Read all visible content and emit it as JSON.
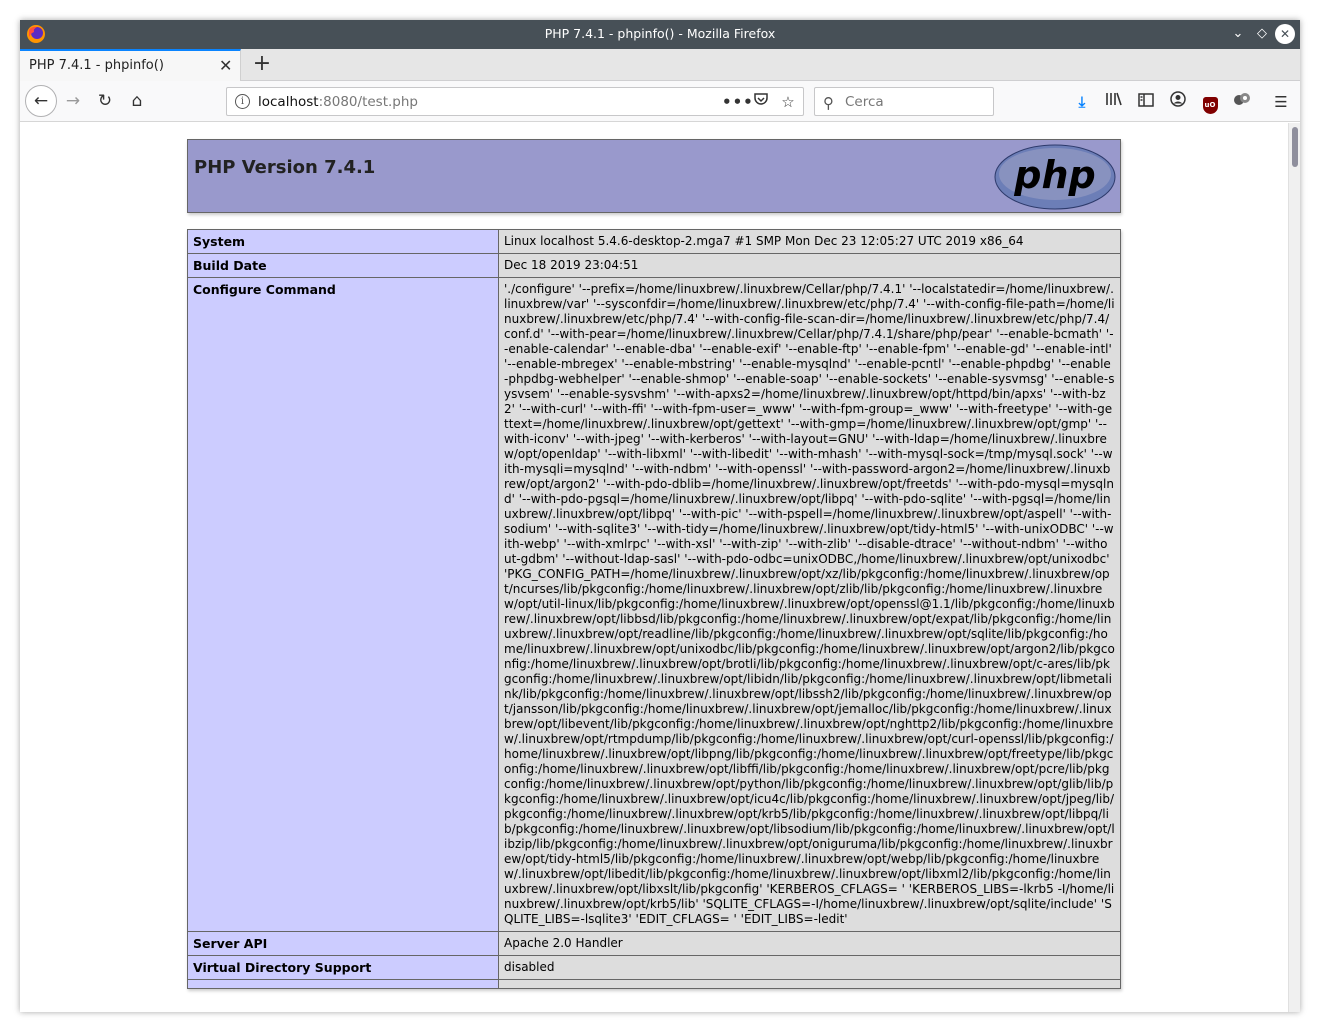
{
  "window": {
    "title": "PHP 7.4.1 - phpinfo() - Mozilla Firefox"
  },
  "tab": {
    "title": "PHP 7.4.1 - phpinfo()"
  },
  "urlbar": {
    "host": "localhost",
    "rest": ":8080/test.php"
  },
  "search": {
    "placeholder": "Cerca"
  },
  "page": {
    "heading": "PHP Version 7.4.1",
    "logo_text": "php",
    "rows": [
      {
        "key": "System",
        "value": "Linux localhost 5.4.6-desktop-2.mga7 #1 SMP Mon Dec 23 12:05:27 UTC 2019 x86_64"
      },
      {
        "key": "Build Date",
        "value": "Dec 18 2019 23:04:51"
      },
      {
        "key": "Configure Command",
        "value": "'./configure' '--prefix=/home/linuxbrew/.linuxbrew/Cellar/php/7.4.1' '--localstatedir=/home/linuxbrew/.linuxbrew/var' '--sysconfdir=/home/linuxbrew/.linuxbrew/etc/php/7.4' '--with-config-file-path=/home/linuxbrew/.linuxbrew/etc/php/7.4' '--with-config-file-scan-dir=/home/linuxbrew/.linuxbrew/etc/php/7.4/conf.d' '--with-pear=/home/linuxbrew/.linuxbrew/Cellar/php/7.4.1/share/php/pear' '--enable-bcmath' '--enable-calendar' '--enable-dba' '--enable-exif' '--enable-ftp' '--enable-fpm' '--enable-gd' '--enable-intl' '--enable-mbregex' '--enable-mbstring' '--enable-mysqlnd' '--enable-pcntl' '--enable-phpdbg' '--enable-phpdbg-webhelper' '--enable-shmop' '--enable-soap' '--enable-sockets' '--enable-sysvmsg' '--enable-sysvsem' '--enable-sysvshm' '--with-apxs2=/home/linuxbrew/.linuxbrew/opt/httpd/bin/apxs' '--with-bz2' '--with-curl' '--with-ffi' '--with-fpm-user=_www' '--with-fpm-group=_www' '--with-freetype' '--with-gettext=/home/linuxbrew/.linuxbrew/opt/gettext' '--with-gmp=/home/linuxbrew/.linuxbrew/opt/gmp' '--with-iconv' '--with-jpeg' '--with-kerberos' '--with-layout=GNU' '--with-ldap=/home/linuxbrew/.linuxbrew/opt/openldap' '--with-libxml' '--with-libedit' '--with-mhash' '--with-mysql-sock=/tmp/mysql.sock' '--with-mysqli=mysqlnd' '--with-ndbm' '--with-openssl' '--with-password-argon2=/home/linuxbrew/.linuxbrew/opt/argon2' '--with-pdo-dblib=/home/linuxbrew/.linuxbrew/opt/freetds' '--with-pdo-mysql=mysqlnd' '--with-pdo-pgsql=/home/linuxbrew/.linuxbrew/opt/libpq' '--with-pdo-sqlite' '--with-pgsql=/home/linuxbrew/.linuxbrew/opt/libpq' '--with-pic' '--with-pspell=/home/linuxbrew/.linuxbrew/opt/aspell' '--with-sodium' '--with-sqlite3' '--with-tidy=/home/linuxbrew/.linuxbrew/opt/tidy-html5' '--with-unixODBC' '--with-webp' '--with-xmlrpc' '--with-xsl' '--with-zip' '--with-zlib' '--disable-dtrace' '--without-ndbm' '--without-gdbm' '--without-ldap-sasl' '--with-pdo-odbc=unixODBC,/home/linuxbrew/.linuxbrew/opt/unixodbc' 'PKG_CONFIG_PATH=/home/linuxbrew/.linuxbrew/opt/xz/lib/pkgconfig:/home/linuxbrew/.linuxbrew/opt/ncurses/lib/pkgconfig:/home/linuxbrew/.linuxbrew/opt/zlib/lib/pkgconfig:/home/linuxbrew/.linuxbrew/opt/util-linux/lib/pkgconfig:/home/linuxbrew/.linuxbrew/opt/openssl@1.1/lib/pkgconfig:/home/linuxbrew/.linuxbrew/opt/libbsd/lib/pkgconfig:/home/linuxbrew/.linuxbrew/opt/expat/lib/pkgconfig:/home/linuxbrew/.linuxbrew/opt/readline/lib/pkgconfig:/home/linuxbrew/.linuxbrew/opt/sqlite/lib/pkgconfig:/home/linuxbrew/.linuxbrew/opt/unixodbc/lib/pkgconfig:/home/linuxbrew/.linuxbrew/opt/argon2/lib/pkgconfig:/home/linuxbrew/.linuxbrew/opt/brotli/lib/pkgconfig:/home/linuxbrew/.linuxbrew/opt/c-ares/lib/pkgconfig:/home/linuxbrew/.linuxbrew/opt/libidn/lib/pkgconfig:/home/linuxbrew/.linuxbrew/opt/libmetalink/lib/pkgconfig:/home/linuxbrew/.linuxbrew/opt/libssh2/lib/pkgconfig:/home/linuxbrew/.linuxbrew/opt/jansson/lib/pkgconfig:/home/linuxbrew/.linuxbrew/opt/jemalloc/lib/pkgconfig:/home/linuxbrew/.linuxbrew/opt/libevent/lib/pkgconfig:/home/linuxbrew/.linuxbrew/opt/nghttp2/lib/pkgconfig:/home/linuxbrew/.linuxbrew/opt/rtmpdump/lib/pkgconfig:/home/linuxbrew/.linuxbrew/opt/curl-openssl/lib/pkgconfig:/home/linuxbrew/.linuxbrew/opt/libpng/lib/pkgconfig:/home/linuxbrew/.linuxbrew/opt/freetype/lib/pkgconfig:/home/linuxbrew/.linuxbrew/opt/libffi/lib/pkgconfig:/home/linuxbrew/.linuxbrew/opt/pcre/lib/pkgconfig:/home/linuxbrew/.linuxbrew/opt/python/lib/pkgconfig:/home/linuxbrew/.linuxbrew/opt/glib/lib/pkgconfig:/home/linuxbrew/.linuxbrew/opt/icu4c/lib/pkgconfig:/home/linuxbrew/.linuxbrew/opt/jpeg/lib/pkgconfig:/home/linuxbrew/.linuxbrew/opt/krb5/lib/pkgconfig:/home/linuxbrew/.linuxbrew/opt/libpq/lib/pkgconfig:/home/linuxbrew/.linuxbrew/opt/libsodium/lib/pkgconfig:/home/linuxbrew/.linuxbrew/opt/libzip/lib/pkgconfig:/home/linuxbrew/.linuxbrew/opt/oniguruma/lib/pkgconfig:/home/linuxbrew/.linuxbrew/opt/tidy-html5/lib/pkgconfig:/home/linuxbrew/.linuxbrew/opt/webp/lib/pkgconfig:/home/linuxbrew/.linuxbrew/opt/libedit/lib/pkgconfig:/home/linuxbrew/.linuxbrew/opt/libxml2/lib/pkgconfig:/home/linuxbrew/.linuxbrew/opt/libxslt/lib/pkgconfig' 'KERBEROS_CFLAGS= ' 'KERBEROS_LIBS=-lkrb5 -I/home/linuxbrew/.linuxbrew/opt/krb5/lib' 'SQLITE_CFLAGS=-I/home/linuxbrew/.linuxbrew/opt/sqlite/include' 'SQLITE_LIBS=-lsqlite3' 'EDIT_CFLAGS= ' 'EDIT_LIBS=-ledit'"
      },
      {
        "key": "Server API",
        "value": "Apache 2.0 Handler"
      },
      {
        "key": "Virtual Directory Support",
        "value": "disabled"
      },
      {
        "key": "",
        "value": ""
      }
    ]
  },
  "colors": {
    "titlebar": "#475057",
    "header_bg": "#9999cc",
    "key_cell_bg": "#ccccff",
    "value_cell_bg": "#dddddd",
    "tab_accent": "#0a84ff"
  }
}
